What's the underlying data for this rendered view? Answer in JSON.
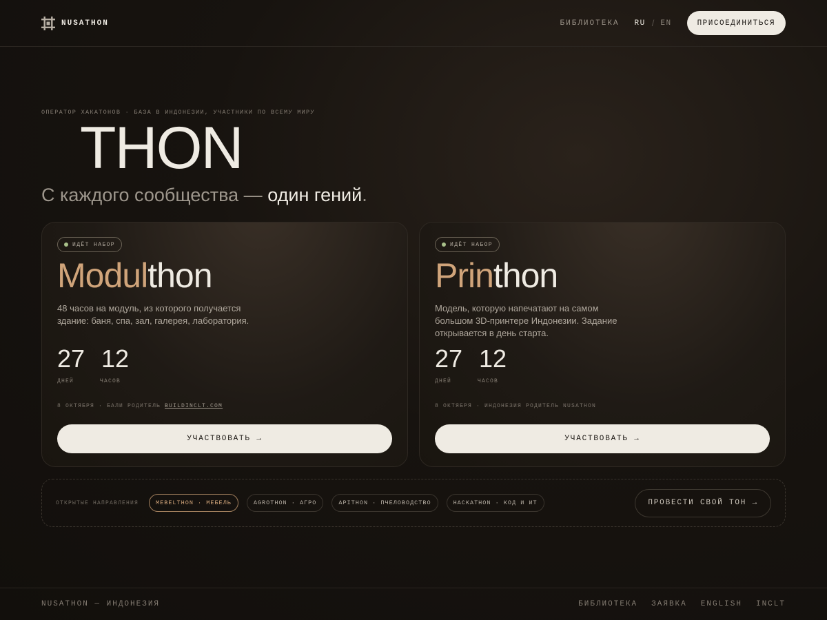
{
  "header": {
    "brand": "NUSATHON",
    "nav_library": "БИБЛИОТЕКА",
    "lang_ru": "RU",
    "lang_sep": "/",
    "lang_en": "EN",
    "join": "ПРИСОЕДИНИТЬСЯ"
  },
  "hero": {
    "eyebrow": "ОПЕРАТОР ХАКАТОНОВ · БАЗА В ИНДОНЕЗИИ, УЧАСТНИКИ ПО ВСЕМУ МИРУ",
    "title": "THON",
    "tagline_start": "С каждого сообщества — ",
    "tagline_highlight": "один гений",
    "tagline_end": "."
  },
  "cards": [
    {
      "badge": "ИДЁТ НАБОР",
      "title_accent": "Modul",
      "title_rest": "thon",
      "description": "48 часов на модуль, из которого получается здание: баня, спа, зал, галерея, лаборатория.",
      "days": "27",
      "days_label": "ДНЕЙ",
      "hours": "12",
      "hours_label": "ЧАСОВ",
      "meta_text": "8 ОКТЯБРЯ · БАЛИ  РОДИТЕЛЬ ",
      "meta_link": "BUILDINCLT.COM",
      "cta": "УЧАСТВОВАТЬ →"
    },
    {
      "badge": "ИДЁТ НАБОР",
      "title_accent": "Prin",
      "title_rest": "thon",
      "description": "Модель, которую напечатают на самом большом 3D-принтере Индонезии. Задание открывается в день старта.",
      "days": "27",
      "days_label": "ДНЕЙ",
      "hours": "12",
      "hours_label": "ЧАСОВ",
      "meta_text": "8 ОКТЯБРЯ · ИНДОНЕЗИЯ  РОДИТЕЛЬ NUSATHON",
      "meta_link": "",
      "cta": "УЧАСТВОВАТЬ →"
    }
  ],
  "tracks": {
    "label": "ОТКРЫТЫЕ НАПРАВЛЕНИЯ",
    "chips": [
      "MEBELTHON · МЕБЕЛЬ",
      "AGROTHON · АГРО",
      "APITHON · ПЧЕЛОВОДСТВО",
      "HACKATHON · КОД И ИТ"
    ],
    "host": "ПРОВЕСТИ СВОЙ ТОН →"
  },
  "footer": {
    "copy": "NUSATHON — ИНДОНЕЗИЯ",
    "links": [
      "БИБЛИОТЕКА",
      "ЗАЯВКА",
      "ENGLISH",
      "INCLT"
    ]
  },
  "colors": {
    "accent": "#d0a47a",
    "background": "#17130f",
    "text": "#efebe3",
    "status_dot": "#a8c08a"
  }
}
